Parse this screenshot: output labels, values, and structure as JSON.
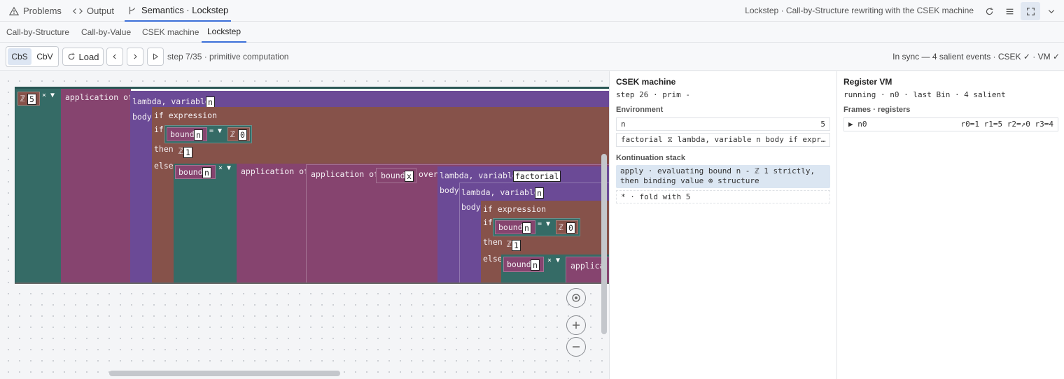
{
  "top_tabs": [
    {
      "label": "Problems",
      "icon": "warning-icon"
    },
    {
      "label": "Output",
      "icon": "code-icon"
    },
    {
      "label": "Semantics · Lockstep",
      "icon": "branch-icon"
    }
  ],
  "window_title": "Lockstep · Call-by-Structure rewriting with the CSEK machine",
  "sub_tabs": [
    "Call-by-Structure",
    "Call-by-Value",
    "CSEK machine",
    "Lockstep"
  ],
  "toolbar": {
    "mode_cbs": "CbS",
    "mode_cbv": "CbV",
    "load_label": "Load",
    "step_text": "step 7/35 · primitive computation",
    "sync_text": "In sync — 4 salient events · CSEK ✓ · VM ✓"
  },
  "tree": {
    "lit5": "5",
    "times": "×",
    "application_of": "application of",
    "lambda_variable": "lambda, variable",
    "var_n": "n",
    "body": "body",
    "if_expression": "if expression",
    "if_kw": "if",
    "bound": "bound",
    "eq": "=",
    "lit0": "0",
    "then_kw": "then",
    "lit1": "1",
    "else_kw": "else",
    "var_x": "x",
    "over": "over",
    "var_factorial": "factorial",
    "applica": "applica",
    "lit_prefix": "ℤ"
  },
  "csek": {
    "title": "CSEK machine",
    "step_line": "step 26 · prim -",
    "env_title": "Environment",
    "env": [
      {
        "name": "n",
        "value": "5"
      },
      {
        "name": "factorial",
        "value": "⧖ lambda, variable n body if expr…"
      }
    ],
    "k_title": "Kontinuation stack",
    "k_items": [
      "apply · evaluating bound n - ℤ 1 strictly, then binding value ⊗ structure",
      "* · fold with 5"
    ]
  },
  "vm": {
    "title": "Register VM",
    "status_line": "running · n0 · last Bin · 4 salient",
    "frames_title": "Frames · registers",
    "frames": [
      {
        "name": "▶ n0",
        "regs": "r0=1 r1=5 r2=↗0 r3=4"
      }
    ]
  }
}
